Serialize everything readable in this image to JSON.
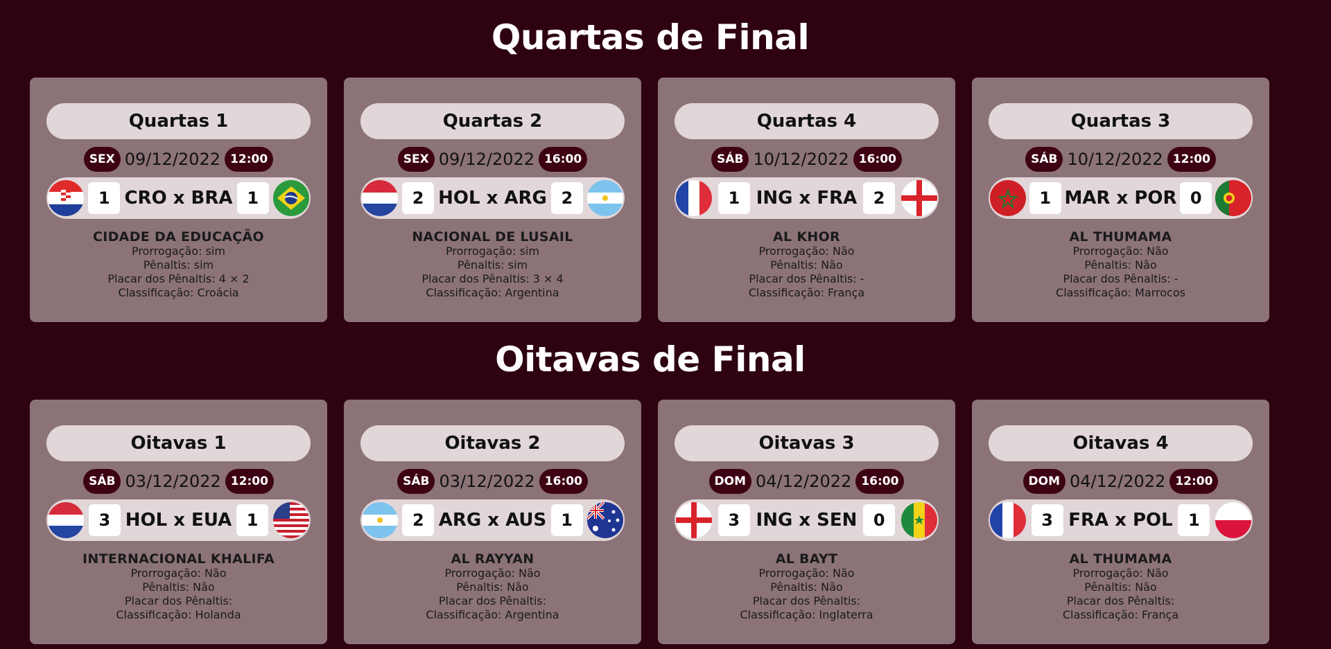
{
  "sections": [
    {
      "title": "Quartas de Final",
      "matches": [
        {
          "title": "Quartas 1",
          "day": "SEX",
          "date": "09/12/2022",
          "time": "12:00",
          "home_flag": "croatia-flag",
          "home_score": "1",
          "teams": "CRO x BRA",
          "away_score": "1",
          "away_flag": "brazil-flag",
          "stadium": "CIDADE DA EDUCAÇÃO",
          "prorrogacao": "Prorrogação: sim",
          "penaltis": "Pênaltis: sim",
          "placar_penaltis": "Placar dos Pênaltis: 4 × 2",
          "classificacao": "Classificação: Croácia"
        },
        {
          "title": "Quartas 2",
          "day": "SEX",
          "date": "09/12/2022",
          "time": "16:00",
          "home_flag": "netherlands-flag",
          "home_score": "2",
          "teams": "HOL x ARG",
          "away_score": "2",
          "away_flag": "argentina-flag",
          "stadium": "NACIONAL DE LUSAIL",
          "prorrogacao": "Prorrogação: sim",
          "penaltis": "Pênaltis: sim",
          "placar_penaltis": "Placar dos Pênaltis: 3 × 4",
          "classificacao": "Classificação: Argentina"
        },
        {
          "title": "Quartas 4",
          "day": "SÁB",
          "date": "10/12/2022",
          "time": "16:00",
          "home_flag": "france-flag",
          "home_score": "1",
          "teams": "ING x FRA",
          "away_score": "2",
          "away_flag": "england-flag",
          "stadium": "AL KHOR",
          "prorrogacao": "Prorrogação: Não",
          "penaltis": "Pênaltis: Não",
          "placar_penaltis": "Placar dos Pênaltis: -",
          "classificacao": "Classificação: França"
        },
        {
          "title": "Quartas 3",
          "day": "SÁB",
          "date": "10/12/2022",
          "time": "12:00",
          "home_flag": "morocco-flag",
          "home_score": "1",
          "teams": "MAR x POR",
          "away_score": "0",
          "away_flag": "portugal-flag",
          "stadium": "AL THUMAMA",
          "prorrogacao": "Prorrogação: Não",
          "penaltis": "Pênaltis: Não",
          "placar_penaltis": "Placar dos Pênaltis: -",
          "classificacao": "Classificação: Marrocos"
        }
      ]
    },
    {
      "title": "Oitavas de Final",
      "matches": [
        {
          "title": "Oitavas 1",
          "day": "SÁB",
          "date": "03/12/2022",
          "time": "12:00",
          "home_flag": "netherlands-flag",
          "home_score": "3",
          "teams": "HOL x EUA",
          "away_score": "1",
          "away_flag": "usa-flag",
          "stadium": "INTERNACIONAL KHALIFA",
          "prorrogacao": "Prorrogação: Não",
          "penaltis": "Pênaltis: Não",
          "placar_penaltis": "Placar dos Pênaltis:",
          "classificacao": "Classificação: Holanda"
        },
        {
          "title": "Oitavas 2",
          "day": "SÁB",
          "date": "03/12/2022",
          "time": "16:00",
          "home_flag": "argentina-flag",
          "home_score": "2",
          "teams": "ARG x AUS",
          "away_score": "1",
          "away_flag": "australia-flag",
          "stadium": "AL RAYYAN",
          "prorrogacao": "Prorrogação: Não",
          "penaltis": "Pênaltis: Não",
          "placar_penaltis": "Placar dos Pênaltis:",
          "classificacao": "Classificação: Argentina"
        },
        {
          "title": "Oitavas 3",
          "day": "DOM",
          "date": "04/12/2022",
          "time": "16:00",
          "home_flag": "england-flag",
          "home_score": "3",
          "teams": "ING x SEN",
          "away_score": "0",
          "away_flag": "senegal-flag",
          "stadium": "AL BAYT",
          "prorrogacao": "Prorrogação: Não",
          "penaltis": "Pênaltis: Não",
          "placar_penaltis": "Placar dos Pênaltis:",
          "classificacao": "Classificação: Inglaterra"
        },
        {
          "title": "Oitavas 4",
          "day": "DOM",
          "date": "04/12/2022",
          "time": "12:00",
          "home_flag": "france-flag",
          "home_score": "3",
          "teams": "FRA x POL",
          "away_score": "1",
          "away_flag": "poland-flag",
          "stadium": "AL THUMAMA",
          "prorrogacao": "Prorrogação: Não",
          "penaltis": "Pênaltis: Não",
          "placar_penaltis": "Placar dos Pênaltis:",
          "classificacao": "Classificação: França"
        }
      ]
    }
  ]
}
